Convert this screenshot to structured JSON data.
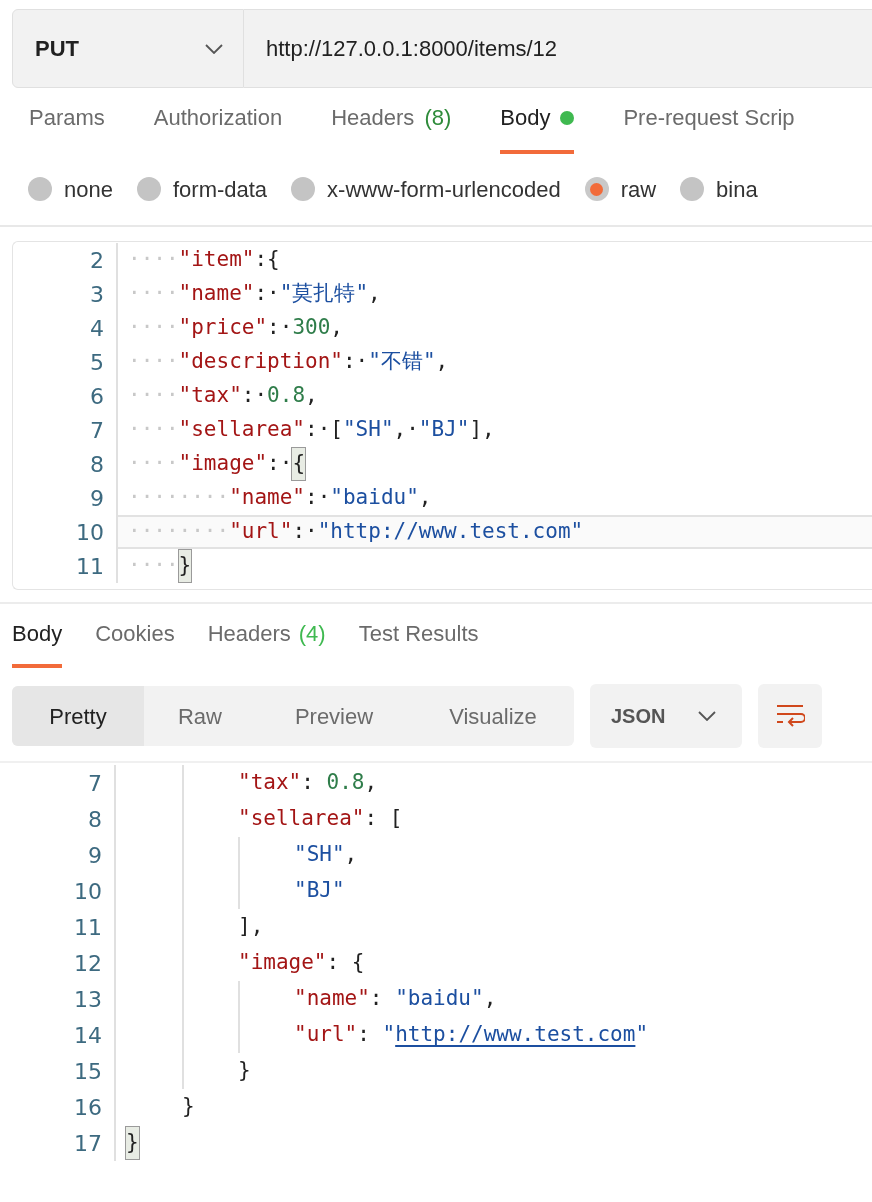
{
  "request": {
    "method": "PUT",
    "url": "http://127.0.0.1:8000/items/12"
  },
  "request_tabs": [
    {
      "label": "Params",
      "selected": false
    },
    {
      "label": "Authorization",
      "selected": false
    },
    {
      "label": "Headers",
      "count": "(8)",
      "selected": false
    },
    {
      "label": "Body",
      "selected": true,
      "dot": true
    },
    {
      "label": "Pre-request Scrip",
      "selected": false
    }
  ],
  "body_types": [
    {
      "label": "none",
      "selected": false
    },
    {
      "label": "form-data",
      "selected": false
    },
    {
      "label": "x-www-form-urlencoded",
      "selected": false
    },
    {
      "label": "raw",
      "selected": true
    },
    {
      "label": "bina",
      "selected": false
    }
  ],
  "request_editor": {
    "lines": [
      {
        "number": "2",
        "active": false,
        "tokens": [
          {
            "kind": "indent",
            "text": "····"
          },
          {
            "kind": "key",
            "text": "\"item\""
          },
          {
            "kind": "punct",
            "text": ":{"
          }
        ]
      },
      {
        "number": "3",
        "active": false,
        "tokens": [
          {
            "kind": "indent",
            "text": "····"
          },
          {
            "kind": "key",
            "text": "\"name\""
          },
          {
            "kind": "punct",
            "text": ":·"
          },
          {
            "kind": "string",
            "text": "\"莫扎特\""
          },
          {
            "kind": "punct",
            "text": ","
          }
        ]
      },
      {
        "number": "4",
        "active": false,
        "tokens": [
          {
            "kind": "indent",
            "text": "····"
          },
          {
            "kind": "key",
            "text": "\"price\""
          },
          {
            "kind": "punct",
            "text": ":·"
          },
          {
            "kind": "number",
            "text": "300"
          },
          {
            "kind": "punct",
            "text": ","
          }
        ]
      },
      {
        "number": "5",
        "active": false,
        "tokens": [
          {
            "kind": "indent",
            "text": "····"
          },
          {
            "kind": "key",
            "text": "\"description\""
          },
          {
            "kind": "punct",
            "text": ":·"
          },
          {
            "kind": "string",
            "text": "\"不错\""
          },
          {
            "kind": "punct",
            "text": ","
          }
        ]
      },
      {
        "number": "6",
        "active": false,
        "tokens": [
          {
            "kind": "indent",
            "text": "····"
          },
          {
            "kind": "key",
            "text": "\"tax\""
          },
          {
            "kind": "punct",
            "text": ":·"
          },
          {
            "kind": "number",
            "text": "0.8"
          },
          {
            "kind": "punct",
            "text": ","
          }
        ]
      },
      {
        "number": "7",
        "active": false,
        "tokens": [
          {
            "kind": "indent",
            "text": "····"
          },
          {
            "kind": "key",
            "text": "\"sellarea\""
          },
          {
            "kind": "punct",
            "text": ":·["
          },
          {
            "kind": "string",
            "text": "\"SH\""
          },
          {
            "kind": "punct",
            "text": ",·"
          },
          {
            "kind": "string",
            "text": "\"BJ\""
          },
          {
            "kind": "punct",
            "text": "],"
          }
        ]
      },
      {
        "number": "8",
        "active": false,
        "tokens": [
          {
            "kind": "indent",
            "text": "····"
          },
          {
            "kind": "key",
            "text": "\"image\""
          },
          {
            "kind": "punct",
            "text": ":·"
          },
          {
            "kind": "bracket",
            "text": "{",
            "matched": true
          }
        ]
      },
      {
        "number": "9",
        "active": false,
        "tokens": [
          {
            "kind": "indent",
            "text": "········"
          },
          {
            "kind": "key",
            "text": "\"name\""
          },
          {
            "kind": "punct",
            "text": ":·"
          },
          {
            "kind": "string",
            "text": "\"baidu\""
          },
          {
            "kind": "punct",
            "text": ","
          }
        ]
      },
      {
        "number": "10",
        "active": true,
        "tokens": [
          {
            "kind": "indent",
            "text": "········"
          },
          {
            "kind": "key",
            "text": "\"url\""
          },
          {
            "kind": "punct",
            "text": ":·"
          },
          {
            "kind": "string",
            "text": "\"http://www.test.com\""
          }
        ]
      },
      {
        "number": "11",
        "active": false,
        "tokens": [
          {
            "kind": "indent",
            "text": "····"
          },
          {
            "kind": "bracket",
            "text": "}",
            "matched": true
          }
        ]
      }
    ]
  },
  "response_tabs": [
    {
      "label": "Body",
      "selected": true
    },
    {
      "label": "Cookies",
      "selected": false
    },
    {
      "label": "Headers",
      "count": "(4)",
      "selected": false
    },
    {
      "label": "Test Results",
      "selected": false
    }
  ],
  "view_modes": [
    {
      "label": "Pretty",
      "selected": true
    },
    {
      "label": "Raw",
      "selected": false
    },
    {
      "label": "Preview",
      "selected": false
    },
    {
      "label": "Visualize",
      "selected": false
    }
  ],
  "format": "JSON",
  "response_editor": {
    "lines": [
      {
        "number": "7",
        "tokens": [
          {
            "kind": "key",
            "text": "\"tax\""
          },
          {
            "kind": "punct",
            "text": ": "
          },
          {
            "kind": "number",
            "text": "0.8"
          },
          {
            "kind": "punct",
            "text": ","
          }
        ]
      },
      {
        "number": "8",
        "tokens": [
          {
            "kind": "key",
            "text": "\"sellarea\""
          },
          {
            "kind": "punct",
            "text": ": ["
          }
        ]
      },
      {
        "number": "9",
        "tokens": [
          {
            "kind": "string",
            "text": "\"SH\""
          },
          {
            "kind": "punct",
            "text": ","
          }
        ]
      },
      {
        "number": "10",
        "tokens": [
          {
            "kind": "string",
            "text": "\"BJ\""
          }
        ]
      },
      {
        "number": "11",
        "tokens": [
          {
            "kind": "punct",
            "text": "],"
          }
        ]
      },
      {
        "number": "12",
        "tokens": [
          {
            "kind": "key",
            "text": "\"image\""
          },
          {
            "kind": "punct",
            "text": ": {"
          }
        ]
      },
      {
        "number": "13",
        "tokens": [
          {
            "kind": "key",
            "text": "\"name\""
          },
          {
            "kind": "punct",
            "text": ": "
          },
          {
            "kind": "string",
            "text": "\"baidu\""
          },
          {
            "kind": "punct",
            "text": ","
          }
        ]
      },
      {
        "number": "14",
        "tokens": [
          {
            "kind": "key",
            "text": "\"url\""
          },
          {
            "kind": "punct",
            "text": ": "
          },
          {
            "kind": "string",
            "text": "\""
          },
          {
            "kind": "link",
            "text": "http://www.test.com"
          },
          {
            "kind": "string",
            "text": "\""
          }
        ]
      },
      {
        "number": "15",
        "tokens": [
          {
            "kind": "punct",
            "text": "}"
          }
        ]
      },
      {
        "number": "16",
        "tokens": [
          {
            "kind": "punct",
            "text": "}"
          }
        ]
      },
      {
        "number": "17",
        "tokens": [
          {
            "kind": "bracket",
            "text": "}",
            "matched": true
          }
        ]
      }
    ]
  }
}
